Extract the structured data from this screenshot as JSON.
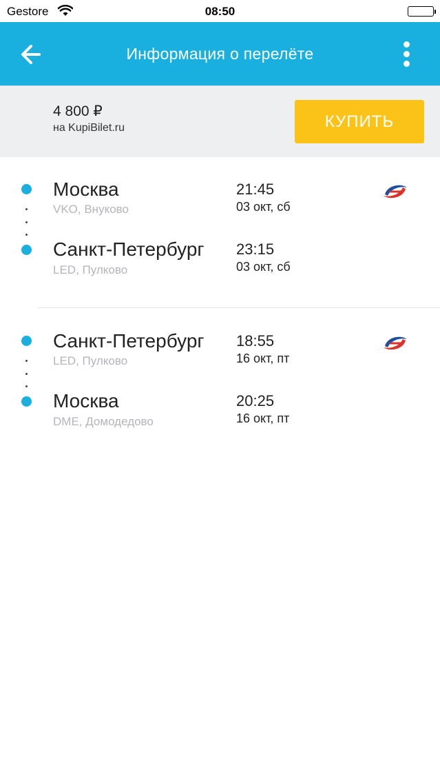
{
  "status_bar": {
    "carrier": "Gestore",
    "time": "08:50"
  },
  "header": {
    "title": "Информация о перелёте",
    "color": "#19b0e0"
  },
  "offer": {
    "price": "4 800 ₽",
    "source": "на KupiBilet.ru",
    "buy_label": "КУПИТЬ",
    "buy_color": "#fbc217"
  },
  "flights": [
    {
      "airline_icon": "airline-logo-icon",
      "departure": {
        "city": "Москва",
        "airport": "VKO, Внуково",
        "time": "21:45",
        "date": "03 окт, сб"
      },
      "arrival": {
        "city": "Санкт-Петербург",
        "airport": "LED, Пулково",
        "time": "23:15",
        "date": "03 окт, сб"
      }
    },
    {
      "airline_icon": "airline-logo-icon",
      "departure": {
        "city": "Санкт-Петербург",
        "airport": "LED, Пулково",
        "time": "18:55",
        "date": "16 окт, пт"
      },
      "arrival": {
        "city": "Москва",
        "airport": "DME, Домодедово",
        "time": "20:25",
        "date": "16 окт, пт"
      }
    }
  ]
}
